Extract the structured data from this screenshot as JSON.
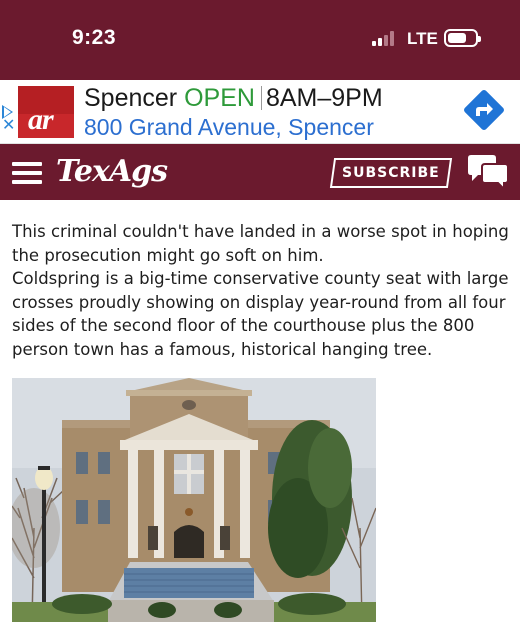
{
  "status_bar": {
    "time": "9:23",
    "network": "LTE",
    "signal_bars_active": 2,
    "signal_bars_total": 4,
    "background_color": "#6b1a2e"
  },
  "ad": {
    "logo_text": "ar",
    "store_name": "Spencer",
    "open_label": "OPEN",
    "hours": "8AM–9PM",
    "address": "800 Grand Avenue, Spencer",
    "open_color": "#2e9a3a",
    "address_color": "#2c6fd0",
    "adchoices_icon": "play-triangle-icon",
    "close_icon": "close-icon",
    "directions_icon": "directions-arrow-icon"
  },
  "nav": {
    "menu_icon": "hamburger-menu-icon",
    "brand": "TexAgs",
    "subscribe_label": "SUBSCRIBE",
    "chat_icon": "chat-bubbles-icon",
    "background_color": "#6b1a2e"
  },
  "article": {
    "paragraph_1": "This criminal couldn't have landed in a worse spot in hoping the prosecution might go soft on him.",
    "paragraph_2": "Coldspring is a big-time conservative county seat with large crosses proudly showing on display year-round from all four sides of the second floor of the courthouse plus the 800 person town has a famous, historical hanging tree."
  },
  "photo": {
    "subject": "courthouse-photo"
  }
}
